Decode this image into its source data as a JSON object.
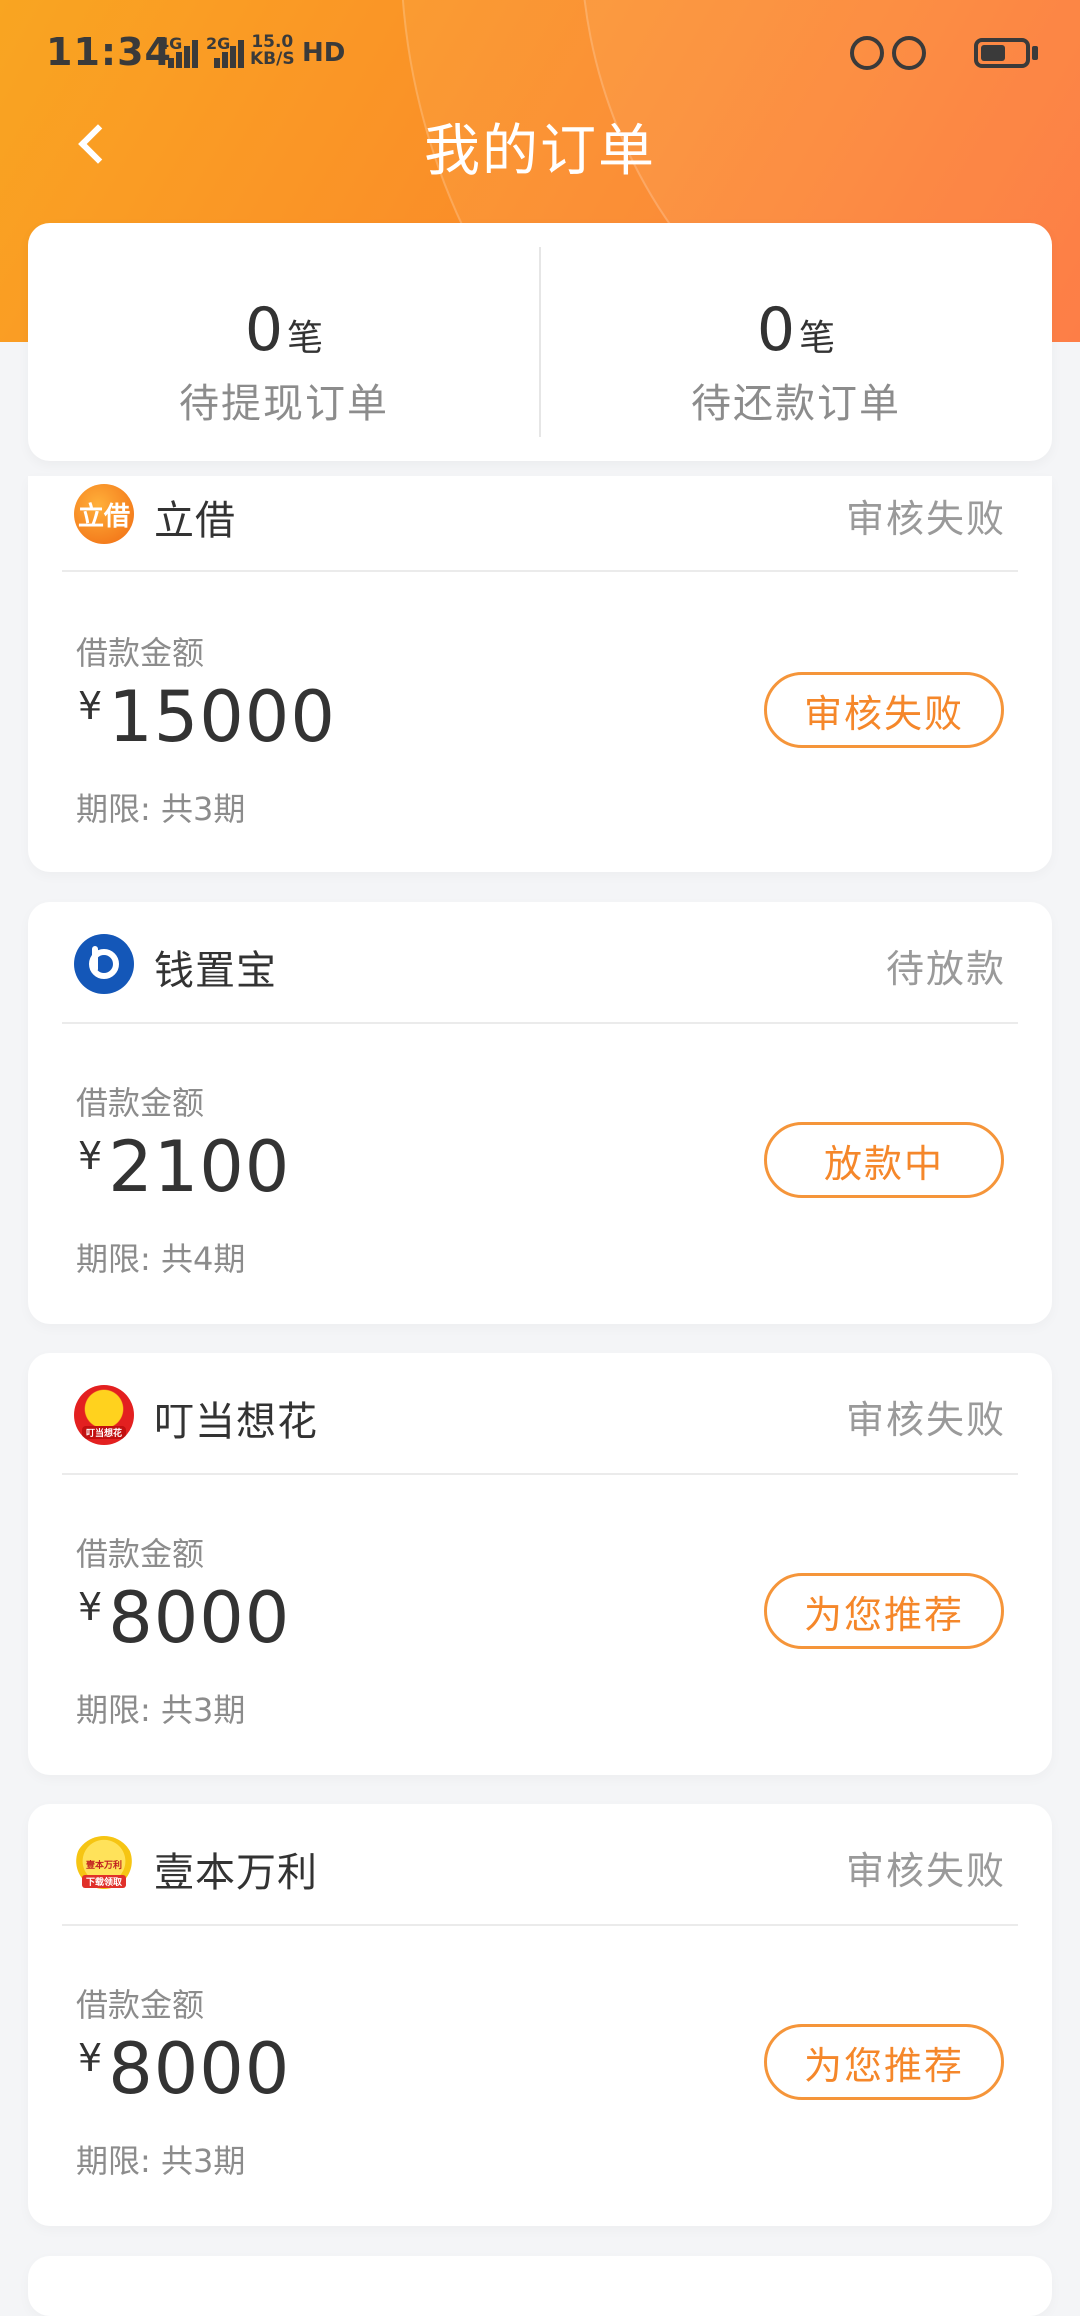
{
  "status_bar": {
    "time": "11:34",
    "net1": "4G",
    "net2": "2G",
    "speed_value": "15.0",
    "speed_unit": "KB/S",
    "hd": "HD"
  },
  "nav": {
    "title": "我的订单"
  },
  "summary": {
    "pending_withdraw": {
      "count": "0",
      "unit": "笔",
      "label": "待提现订单"
    },
    "pending_repay": {
      "count": "0",
      "unit": "笔",
      "label": "待还款订单"
    }
  },
  "orders": [
    {
      "lender": "立借",
      "logo_text": "立借",
      "status": "审核失败",
      "amount_label": "借款金额",
      "currency": "¥",
      "amount": "15000",
      "term": "期限: 共3期",
      "action": "审核失败"
    },
    {
      "lender": "钱置宝",
      "status": "待放款",
      "amount_label": "借款金额",
      "currency": "¥",
      "amount": "2100",
      "term": "期限: 共4期",
      "action": "放款中"
    },
    {
      "lender": "叮当想花",
      "logo_text": "叮当想花",
      "status": "审核失败",
      "amount_label": "借款金额",
      "currency": "¥",
      "amount": "8000",
      "term": "期限: 共3期",
      "action": "为您推荐"
    },
    {
      "lender": "壹本万利",
      "logo_text": "壹本万利",
      "logo_tag": "下载领取",
      "status": "审核失败",
      "amount_label": "借款金额",
      "currency": "¥",
      "amount": "8000",
      "term": "期限: 共3期",
      "action": "为您推荐"
    }
  ]
}
